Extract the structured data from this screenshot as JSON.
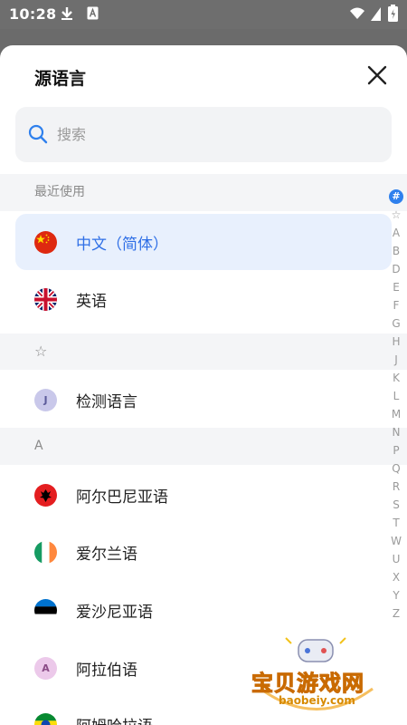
{
  "status_bar": {
    "time": "10:28"
  },
  "sheet": {
    "title": "源语言",
    "search": {
      "placeholder": "搜索"
    }
  },
  "sections": {
    "recent": "最近使用",
    "star": "☆",
    "a": "A"
  },
  "recent_items": [
    {
      "label": "中文（简体）",
      "flag": "china",
      "selected": true
    },
    {
      "label": "英语",
      "flag": "uk",
      "selected": false
    }
  ],
  "starred_items": [
    {
      "label": "检测语言",
      "badge": "J"
    }
  ],
  "a_items": [
    {
      "label": "阿尔巴尼亚语",
      "flag": "albania"
    },
    {
      "label": "爱尔兰语",
      "flag": "ireland"
    },
    {
      "label": "爱沙尼亚语",
      "flag": "estonia"
    },
    {
      "label": "阿拉伯语",
      "badge": "A"
    },
    {
      "label": "阿姆哈拉语",
      "flag": "ethiopia"
    }
  ],
  "index_bar": [
    "#",
    "☆",
    "A",
    "B",
    "D",
    "E",
    "F",
    "G",
    "H",
    "J",
    "K",
    "L",
    "M",
    "N",
    "P",
    "Q",
    "R",
    "S",
    "T",
    "W",
    "U",
    "X",
    "Y",
    "Z"
  ],
  "watermark": {
    "title": "宝贝游戏网",
    "url": "baobeiy.com"
  },
  "colors": {
    "accent": "#2f80ed",
    "selected_bg": "#e8f0fd",
    "section_bg": "#f4f5f7"
  }
}
